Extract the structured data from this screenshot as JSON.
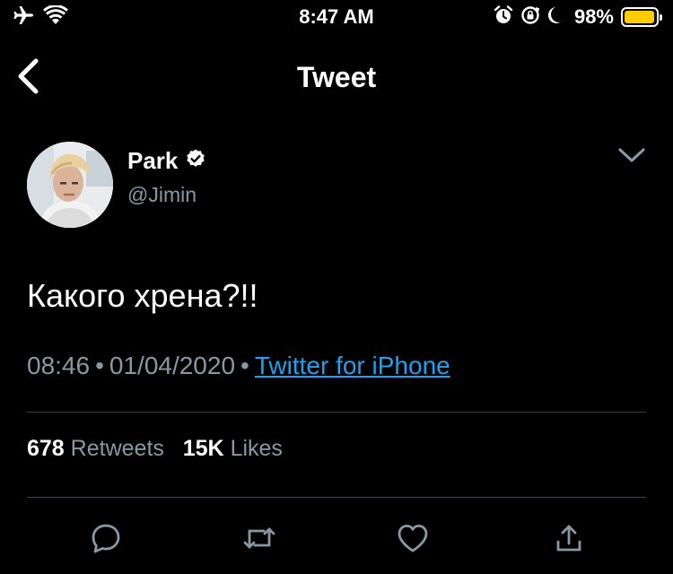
{
  "status_bar": {
    "time": "8:47 AM",
    "battery_percent": "98%",
    "battery_level": 0.98,
    "battery_color": "#ffcc00",
    "icons_left": [
      "airplane-icon",
      "wifi-icon"
    ],
    "icons_right": [
      "alarm-icon",
      "rotation-lock-icon",
      "moon-icon",
      "battery-icon"
    ]
  },
  "header": {
    "title": "Tweet",
    "back_icon": "chevron-left-icon"
  },
  "tweet": {
    "author": {
      "name": "Park",
      "handle": "@Jimin",
      "verified": true
    },
    "text": "Какого хрена?!!",
    "time": "08:46",
    "date": "01/04/2020",
    "separator": "•",
    "source": "Twitter for iPhone",
    "stats": {
      "retweets_count": "678",
      "retweets_label": "Retweets",
      "likes_count": "15K",
      "likes_label": "Likes"
    }
  },
  "actions": [
    "reply-icon",
    "retweet-icon",
    "like-icon",
    "share-icon"
  ],
  "colors": {
    "background": "#000000",
    "secondary_text": "#8899a6",
    "link": "#1da1f2",
    "divider": "#38444d"
  }
}
